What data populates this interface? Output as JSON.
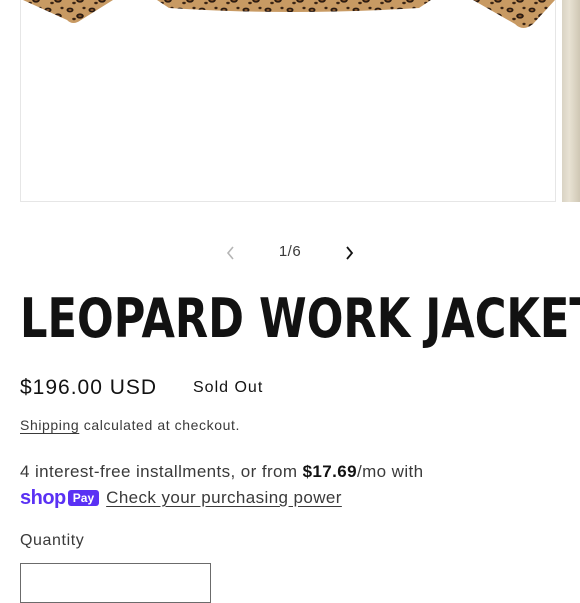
{
  "gallery": {
    "counter": "1/6",
    "prev_icon": "chevron-left-icon",
    "next_icon": "chevron-right-icon"
  },
  "product": {
    "title": "LEOPARD WORK JACKET",
    "price": "$196.00 USD",
    "availability": "Sold Out"
  },
  "shipping": {
    "link_label": "Shipping",
    "note": " calculated at checkout."
  },
  "installments": {
    "text_before": "4 interest-free installments, or from ",
    "amount": "$17.69",
    "text_after": "/mo with",
    "shop_word": "shop",
    "pay_badge": "Pay",
    "check_link": "Check your purchasing power"
  },
  "quantity": {
    "label": "Quantity"
  },
  "colors": {
    "shop_pay": "#5a31f4",
    "text": "#121212"
  }
}
